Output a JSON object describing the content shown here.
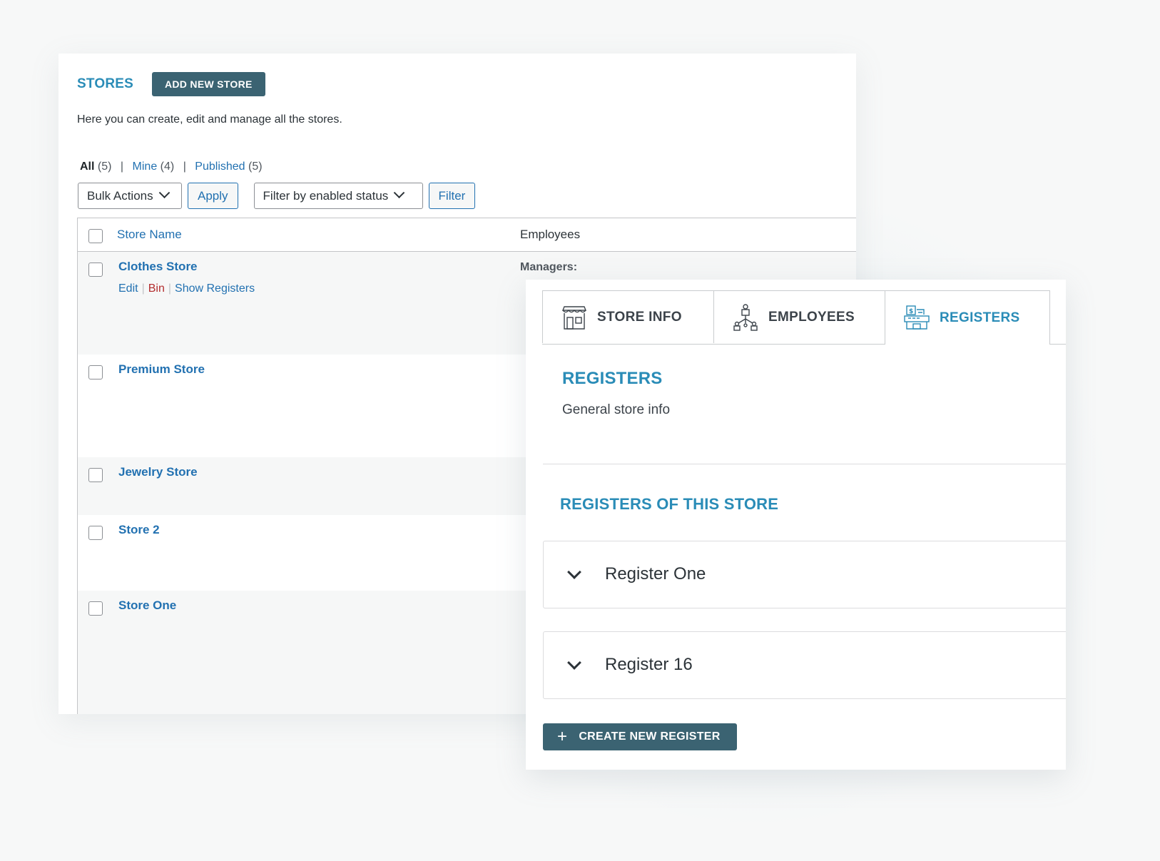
{
  "stores_page": {
    "title": "STORES",
    "add_button": "ADD NEW STORE",
    "description": "Here you can create, edit and manage all the stores.",
    "views": {
      "all_label": "All",
      "all_count": "(5)",
      "mine_label": "Mine",
      "mine_count": "(4)",
      "published_label": "Published",
      "published_count": "(5)",
      "separator": "|"
    },
    "bulk_actions": "Bulk Actions",
    "apply_button": "Apply",
    "status_filter": "Filter by enabled status",
    "filter_button": "Filter",
    "columns": {
      "name": "Store Name",
      "employees": "Employees"
    },
    "rows": [
      {
        "name": "Clothes Store",
        "managers_label": "Managers:"
      },
      {
        "name": "Premium Store"
      },
      {
        "name": "Jewelry Store"
      },
      {
        "name": "Store 2"
      },
      {
        "name": "Store One"
      }
    ],
    "row_actions": {
      "edit": "Edit",
      "bin": "Bin",
      "show_registers": "Show Registers",
      "bar": "|"
    }
  },
  "editor": {
    "tabs": [
      {
        "label": "STORE INFO",
        "icon": "store-icon"
      },
      {
        "label": "EMPLOYEES",
        "icon": "employees-icon"
      },
      {
        "label": "REGISTERS",
        "icon": "register-icon",
        "active": true
      }
    ],
    "section_title": "REGISTERS",
    "section_desc": "General store info",
    "registers_title": "REGISTERS OF THIS STORE",
    "registers": [
      {
        "label": "Register One"
      },
      {
        "label": "Register 16"
      }
    ],
    "create_button": "CREATE NEW REGISTER",
    "create_icon": "+"
  },
  "colors": {
    "accent": "#2a8cb7",
    "link": "#2271b1",
    "button_dark": "#3b6372",
    "danger": "#b32d2e"
  }
}
